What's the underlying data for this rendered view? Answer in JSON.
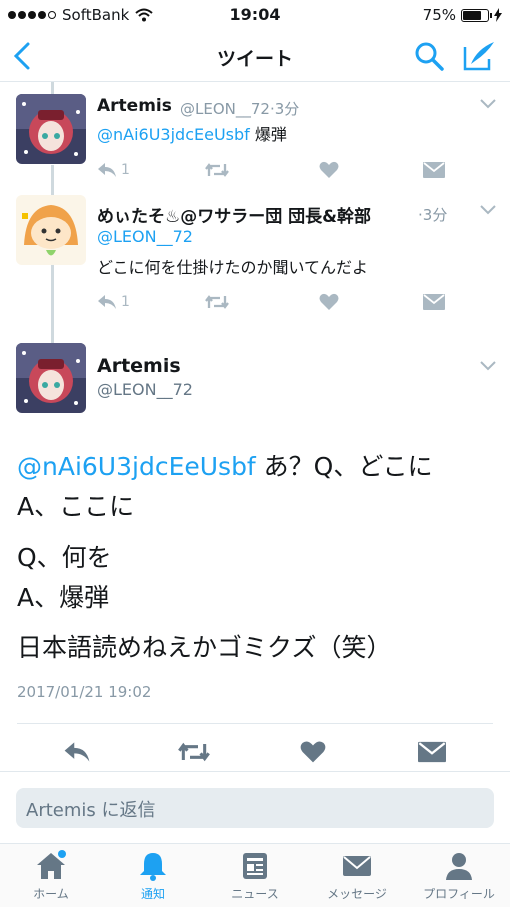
{
  "status_bar": {
    "carrier": "SoftBank",
    "time": "19:04",
    "battery": "75%",
    "battery_level": 0.75
  },
  "nav": {
    "title": "ツイート"
  },
  "tweets": [
    {
      "name": "Artemis",
      "handle": "@LEON__72",
      "time": "3分",
      "mention": "@nAi6U3jdcEeUsbf",
      "text": "爆弾",
      "reply_count": "1"
    },
    {
      "name": "めぃたそ♨@ワサラー団 団長&幹部",
      "handle_time": "3分",
      "mention": "@LEON__72",
      "text": "どこに何を仕掛けたのか聞いてんだよ",
      "reply_count": "1"
    }
  ],
  "main_tweet": {
    "name": "Artemis",
    "handle": "@LEON__72",
    "mention": "@nAi6U3jdcEeUsbf",
    "line1_rest": " あ？Q、どこに",
    "line2": " A、ここに",
    "line3": "Q、何を",
    "line4": "A、爆弾",
    "line5": "日本語読めねえかゴミクズ（笑）",
    "date": "2017/01/21 19:02"
  },
  "reply": {
    "placeholder": "Artemis に返信"
  },
  "tabs": [
    {
      "label": "ホーム",
      "icon": "home-icon"
    },
    {
      "label": "通知",
      "icon": "bell-icon",
      "active": true
    },
    {
      "label": "ニュース",
      "icon": "news-icon"
    },
    {
      "label": "メッセージ",
      "icon": "envelope-icon"
    },
    {
      "label": "プロフィール",
      "icon": "person-icon"
    }
  ],
  "colors": {
    "accent": "#1da1f2",
    "muted": "#aab8c2",
    "text": "#14171a"
  }
}
